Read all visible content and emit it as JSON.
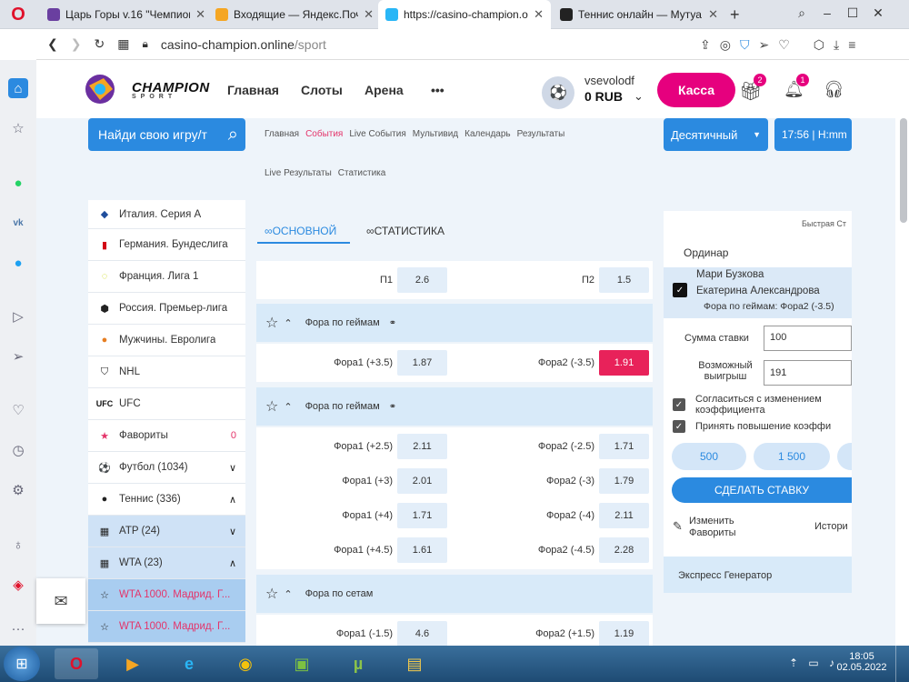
{
  "browser": {
    "tabs": [
      {
        "title": "Царь Горы v.16 \"Чемпион",
        "fav_color": "#6a3fa0"
      },
      {
        "title": "Входящие — Яндекс.Почта",
        "fav_color": "#f5a623"
      },
      {
        "title": "https://casino-champion.o",
        "fav_color": "#29b6f6"
      },
      {
        "title": "Теннис онлайн — Мутуа",
        "fav_color": "#222222"
      }
    ],
    "new_tab": "+",
    "url_domain": "casino-champion.online",
    "url_path": "/sport"
  },
  "header": {
    "brand": "CHAMPION",
    "brand_sub": "SPORT",
    "nav": [
      "Главная",
      "Слоты",
      "Арена"
    ],
    "more": "•••",
    "username": "vsevolodf",
    "balance": "0 RUB",
    "kassa": "Касса",
    "gift_badge": "2",
    "bell_badge": "1"
  },
  "toolbar": {
    "search_placeholder": "Найди свою игру/т",
    "links_row1": [
      "Главная",
      "События",
      "Live События",
      "Мультивид",
      "Календарь",
      "Результаты"
    ],
    "active_link": "События",
    "links_row2": [
      "Live Результаты",
      "Статистика"
    ],
    "odds_format": "Десятичный",
    "time": "17:56 | H:mm"
  },
  "menu": {
    "items": [
      {
        "label": "Италия. Серия А",
        "icon": "seriea-icon",
        "count": ""
      },
      {
        "label": "Германия. Бундеслига",
        "icon": "bundesliga-icon",
        "count": ""
      },
      {
        "label": "Франция. Лига 1",
        "icon": "ligue1-icon",
        "count": ""
      },
      {
        "label": "Россия. Премьер-лига",
        "icon": "rpl-icon",
        "count": ""
      },
      {
        "label": "Мужчины. Евролига",
        "icon": "basketball-icon",
        "count": ""
      },
      {
        "label": "NHL",
        "icon": "nhl-icon",
        "count": ""
      },
      {
        "label": "UFC",
        "icon": "ufc-icon",
        "count": ""
      },
      {
        "label": "Фавориты",
        "icon": "star-icon",
        "count": "0"
      },
      {
        "label": "Футбол (1034)",
        "icon": "football-icon",
        "count": "∨"
      },
      {
        "label": "Теннис (336)",
        "icon": "tennis-icon",
        "count": "∧"
      },
      {
        "label": "ATP (24)",
        "icon": "map-icon",
        "count": "∨"
      },
      {
        "label": "WTA (23)",
        "icon": "map-icon",
        "count": "∧"
      },
      {
        "label": "WTA 1000. Мадрид. Г...",
        "icon": "star-outline-icon",
        "count": ""
      },
      {
        "label": "WTA 1000. Мадрид. Г...",
        "icon": "star-outline-icon",
        "count": ""
      }
    ]
  },
  "center": {
    "tab_main": "ОСНОВНОЙ",
    "tab_stats": "СТАТИСТИКА",
    "p1_label": "П1",
    "p1_odd": "2.6",
    "p2_label": "П2",
    "p2_odd": "1.5",
    "sections": [
      {
        "title": "Фора по геймам",
        "rows": [
          {
            "l": "Фора1 (+3.5)",
            "lo": "1.87",
            "r": "Фора2 (-3.5)",
            "ro": "1.91",
            "rsel": true
          }
        ]
      },
      {
        "title": "Фора по геймам",
        "rows": [
          {
            "l": "Фора1 (+2.5)",
            "lo": "2.11",
            "r": "Фора2 (-2.5)",
            "ro": "1.71"
          },
          {
            "l": "Фора1 (+3)",
            "lo": "2.01",
            "r": "Фора2 (-3)",
            "ro": "1.79"
          },
          {
            "l": "Фора1 (+4)",
            "lo": "1.71",
            "r": "Фора2 (-4)",
            "ro": "2.11"
          },
          {
            "l": "Фора1 (+4.5)",
            "lo": "1.61",
            "r": "Фора2 (-4.5)",
            "ro": "2.28"
          }
        ]
      },
      {
        "title": "Фора по сетам",
        "rows": [
          {
            "l": "Фора1 (-1.5)",
            "lo": "4.6",
            "r": "Фора2 (+1.5)",
            "ro": "1.19"
          }
        ]
      }
    ]
  },
  "coupon": {
    "quick": "Быстрая Ст",
    "tab": "Ординар",
    "player1": "Мари Бузкова",
    "player2": "Екатерина Александрова",
    "market": "Фора по геймам: Фора2 (-3.5)",
    "stake_label": "Сумма ставки",
    "stake_value": "100",
    "win_label1": "Возможный",
    "win_label2": "выигрыш",
    "win_value": "191",
    "agree1": "Согласиться с изменением",
    "agree1b": "коэффициента",
    "agree2": "Принять повышение коэффи",
    "quick1": "500",
    "quick2": "1 500",
    "submit": "СДЕЛАТЬ СТАВКУ",
    "edit1": "Изменить",
    "edit2": "Фавориты",
    "history": "Истори",
    "express": "Экспресс Генератор"
  },
  "taskbar": {
    "time": "18:05",
    "date": "02.05.2022"
  },
  "colors": {
    "accent": "#2b8ae0",
    "brand": "#e6007e",
    "odd_selected": "#e8225a"
  }
}
